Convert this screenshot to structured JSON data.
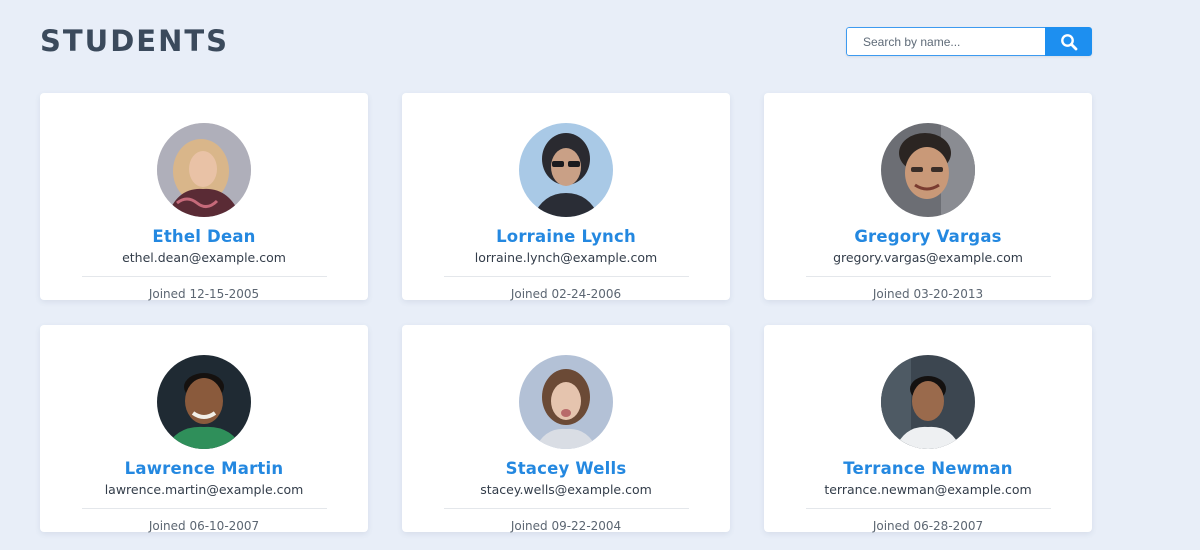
{
  "header": {
    "title": "STUDENTS"
  },
  "search": {
    "placeholder": "Search by name...",
    "value": "",
    "button_icon": "search-icon"
  },
  "colors": {
    "background": "#e8eef8",
    "accent": "#1d8ff0",
    "name": "#2488e0",
    "title": "#3b4a5c"
  },
  "students": [
    {
      "name": "Ethel Dean",
      "email": "ethel.dean@example.com",
      "joined": "Joined 12-15-2005"
    },
    {
      "name": "Lorraine Lynch",
      "email": "lorraine.lynch@example.com",
      "joined": "Joined 02-24-2006"
    },
    {
      "name": "Gregory Vargas",
      "email": "gregory.vargas@example.com",
      "joined": "Joined 03-20-2013"
    },
    {
      "name": "Lawrence Martin",
      "email": "lawrence.martin@example.com",
      "joined": "Joined 06-10-2007"
    },
    {
      "name": "Stacey Wells",
      "email": "stacey.wells@example.com",
      "joined": "Joined 09-22-2004"
    },
    {
      "name": "Terrance Newman",
      "email": "terrance.newman@example.com",
      "joined": "Joined 06-28-2007"
    }
  ]
}
